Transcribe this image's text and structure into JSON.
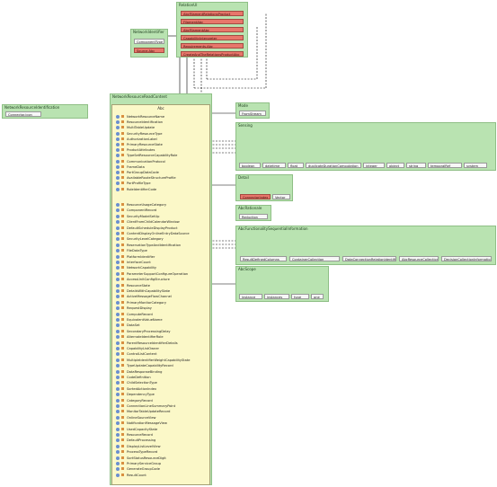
{
  "diagram": {
    "top_cluster": {
      "title": "RelationUI",
      "items": [
        "AbcFilamentRelationsProduct",
        "FilamentAbc",
        "AbcFilamentAbc",
        "CapabilityInterpreter",
        "Requirements.Abc",
        "CreateAndTheRelationsProductAbc"
      ]
    },
    "left_small": {
      "title": "NetworkIdentifier",
      "items": [
        "ComponentType",
        "Source.Abc"
      ]
    },
    "far_left": {
      "title": "NetworkResourceIdentification",
      "items": [
        "Connector.icon"
      ]
    },
    "main": {
      "title": "NetworkResourceReadContent",
      "subtitle": "Abc",
      "rows_group1": [
        "NetworkResourceName",
        "ResourceIdentification",
        "MultiTableUpdate",
        "SecurityResourceType",
        "AuthorizationLabel",
        "PrimaryResourceState",
        "ProductAttributes",
        "TypeSetResourceCapabilityRole",
        "CommunicationProtocol",
        "FrameData",
        "PortGroupDataCode",
        "AvailableRouteStructureProfile",
        "PortProfileType",
        "RoleIdentifierCode"
      ],
      "rows_group2": [
        "ResourceUsageCategory",
        "ComponentRecord",
        "SecurityModelSetUp",
        "ClientFromChildCalendarWindow",
        "DefaultScheduleDisplayProduct",
        "ContentDisplayOnlineEntryDataSource",
        "SecurityLevelCategory",
        "ReservationTypeAndIdentification",
        "FileDataType",
        "PlatformIdentifier",
        "InterfaceCount",
        "NetworkCapability",
        "ParameterSupportConfigureOperation",
        "AccessUnitConfigStructure",
        "ResourceState",
        "DetailsWithCapabilityState",
        "ActiveMessageFlowChannel",
        "PrimaryMonitorCategory",
        "RequestDisplay",
        "ComputeRecord",
        "EquivalentValueName",
        "DataSet",
        "SecondaryProcessingDelay",
        "AlternateIdentifierRole",
        "ParentResourceIdentifierDetails",
        "CapabilityListOwner",
        "ControlListContent",
        "MultipleIdentifierWeightCapabilityState",
        "TypeUpdateCapabilityRecord",
        "DataResponseBinding",
        "CodeDefinition",
        "ChildSelectionType",
        "SortedActionIndex",
        "DependencyType",
        "CategoryRecord",
        "ConnectionLineSummaryPoint",
        "MonitorTableUpdateRecord",
        "OnlineSourceView",
        "NotificationMessageView",
        "UsedCapacityState",
        "ResourceRecord",
        "DefaultProcessing",
        "DisplayListLevelView",
        "ProcessTypeRecord",
        "SortStatusResourceDigit",
        "PrimaryServiceGroup",
        "GenerateGroupCode",
        "ResultCount"
      ]
    },
    "mode": {
      "title": "Mode",
      "items": [
        "FromStream"
      ]
    },
    "sensing": {
      "title": "Sensing",
      "items": [
        "boolean",
        "datetime",
        "float",
        "duplicateDurationComputation",
        "integer",
        "object",
        "string",
        "temporalRef",
        "system"
      ]
    },
    "detail": {
      "title": "Detail",
      "items": [
        "ConnectorIndex",
        "Vector"
      ]
    },
    "architecture": {
      "title": "AbcRationale",
      "items": [
        "Reduction"
      ]
    },
    "enum_group": {
      "title": "AbcFunctionalitySequentialInformation",
      "items": [
        "ResultDefinedColumns",
        "ContainerCollection",
        "DataConnectionRelationIdentifier",
        "AbcResourceCollection",
        "DecisionCollectionInformation"
      ]
    },
    "scope": {
      "title": "AbcScope",
      "items": [
        "instance",
        "instances",
        "type",
        "one"
      ]
    },
    "colors": {
      "group_fill": "#b9e3b1",
      "main_fill": "#fbf8c8",
      "highlight": "#e8776b"
    }
  }
}
